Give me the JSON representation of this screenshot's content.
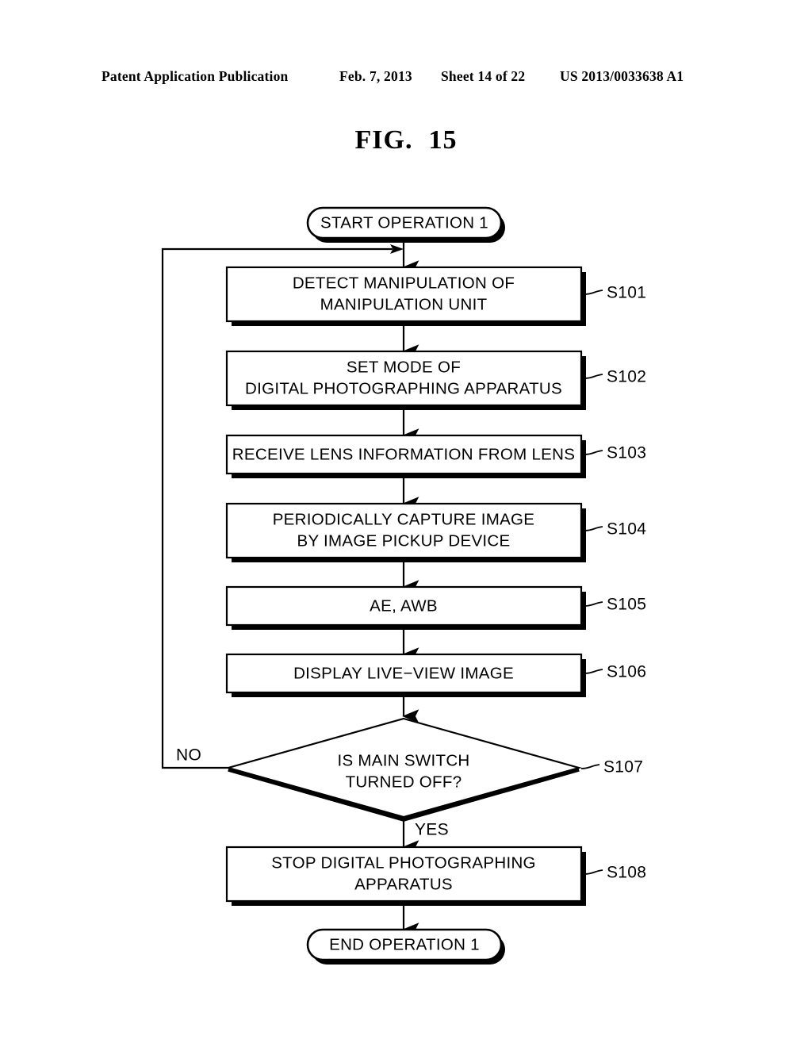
{
  "header": {
    "publication": "Patent Application Publication",
    "date": "Feb. 7, 2013",
    "sheet": "Sheet 14 of 22",
    "number": "US 2013/0033638 A1"
  },
  "figure": {
    "label": "FIG.",
    "number": "15"
  },
  "flowchart": {
    "start": {
      "text": "START OPERATION 1"
    },
    "end": {
      "text": "END OPERATION 1"
    },
    "steps": [
      {
        "id": "S101",
        "lines": [
          "DETECT MANIPULATION OF",
          "MANIPULATION UNIT"
        ]
      },
      {
        "id": "S102",
        "lines": [
          "SET MODE OF",
          "DIGITAL PHOTOGRAPHING APPARATUS"
        ]
      },
      {
        "id": "S103",
        "lines": [
          "RECEIVE LENS INFORMATION FROM LENS"
        ]
      },
      {
        "id": "S104",
        "lines": [
          "PERIODICALLY CAPTURE IMAGE",
          "BY IMAGE PICKUP DEVICE"
        ]
      },
      {
        "id": "S105",
        "lines": [
          "AE, AWB"
        ]
      },
      {
        "id": "S106",
        "lines": [
          "DISPLAY LIVE−VIEW IMAGE"
        ]
      },
      {
        "id": "S108",
        "lines": [
          "STOP DIGITAL PHOTOGRAPHING",
          "APPARATUS"
        ]
      }
    ],
    "decision": {
      "id": "S107",
      "lines": [
        "IS MAIN SWITCH",
        "TURNED OFF?"
      ],
      "no_label": "NO",
      "yes_label": "YES"
    }
  },
  "colors": {
    "ink": "#000000",
    "paper": "#ffffff"
  }
}
